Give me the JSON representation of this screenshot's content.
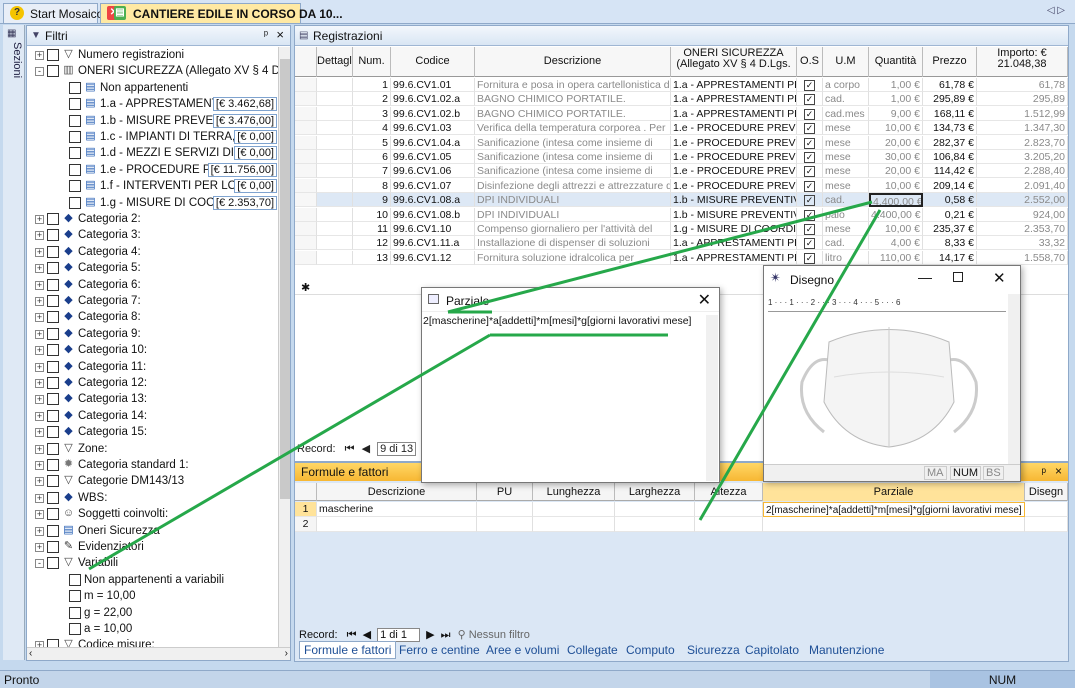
{
  "tabs": [
    {
      "label": "Start Mosaico"
    },
    {
      "label": "CANTIERE EDILE IN CORSO DA 10..."
    }
  ],
  "nav_arrows": "◁ ▷",
  "sidebar": {
    "vertical_label": "Sezioni"
  },
  "filtri": {
    "title": "Filtri",
    "tree": [
      {
        "label": "Numero registrazioni",
        "icon": "filter",
        "level": 0,
        "expander": "+"
      },
      {
        "label": "ONERI SICUREZZA (Allegato XV § 4 D.Lgs.",
        "icon": "book",
        "level": 0,
        "expander": "-"
      },
      {
        "label": "Non appartenenti",
        "icon": "doc",
        "level": 1
      },
      {
        "label": "1.a - APPRESTAMENTI PRE",
        "icon": "doc",
        "level": 1,
        "value": "[€ 3.462,68]"
      },
      {
        "label": "1.b - MISURE PREVENTIVE E",
        "icon": "doc",
        "level": 1,
        "value": "[€ 3.476,00]"
      },
      {
        "label": "1.c - IMPIANTI DI TERRA, DI PR",
        "icon": "doc",
        "level": 1,
        "value": "[€ 0,00]"
      },
      {
        "label": "1.d - MEZZI E SERVIZI DI PROTE",
        "icon": "doc",
        "level": 1,
        "value": "[€ 0,00]"
      },
      {
        "label": "1.e - PROCEDURE PREVIS",
        "icon": "doc",
        "level": 1,
        "value": "[€ 11.756,00]"
      },
      {
        "label": "1.f - INTERVENTI PER LO SFASA",
        "icon": "doc",
        "level": 1,
        "value": "[€ 0,00]"
      },
      {
        "label": "1.g - MISURE DI COORDIN",
        "icon": "doc",
        "level": 1,
        "value": "[€ 2.353,70]"
      },
      {
        "label": "Categoria 2:",
        "icon": "books",
        "level": 0,
        "expander": "+"
      },
      {
        "label": "Categoria 3:",
        "icon": "books",
        "level": 0,
        "expander": "+"
      },
      {
        "label": "Categoria 4:",
        "icon": "books",
        "level": 0,
        "expander": "+"
      },
      {
        "label": "Categoria 5:",
        "icon": "books",
        "level": 0,
        "expander": "+"
      },
      {
        "label": "Categoria 6:",
        "icon": "books",
        "level": 0,
        "expander": "+"
      },
      {
        "label": "Categoria 7:",
        "icon": "books",
        "level": 0,
        "expander": "+"
      },
      {
        "label": "Categoria 8:",
        "icon": "books",
        "level": 0,
        "expander": "+"
      },
      {
        "label": "Categoria 9:",
        "icon": "books",
        "level": 0,
        "expander": "+"
      },
      {
        "label": "Categoria 10:",
        "icon": "books",
        "level": 0,
        "expander": "+"
      },
      {
        "label": "Categoria 11:",
        "icon": "books",
        "level": 0,
        "expander": "+"
      },
      {
        "label": "Categoria 12:",
        "icon": "books",
        "level": 0,
        "expander": "+"
      },
      {
        "label": "Categoria 13:",
        "icon": "books",
        "level": 0,
        "expander": "+"
      },
      {
        "label": "Categoria 14:",
        "icon": "books",
        "level": 0,
        "expander": "+"
      },
      {
        "label": "Categoria 15:",
        "icon": "books",
        "level": 0,
        "expander": "+"
      },
      {
        "label": "Zone:",
        "icon": "filter",
        "level": 0,
        "expander": "+"
      },
      {
        "label": "Categoria standard 1:",
        "icon": "gear",
        "level": 0,
        "expander": "+"
      },
      {
        "label": "Categorie DM143/13",
        "icon": "filter",
        "level": 0,
        "expander": "+"
      },
      {
        "label": "WBS:",
        "icon": "books",
        "level": 0,
        "expander": "+"
      },
      {
        "label": "Soggetti coinvolti:",
        "icon": "person",
        "level": 0,
        "expander": "+"
      },
      {
        "label": "Oneri Sicurezza",
        "icon": "doc",
        "level": 0,
        "expander": "+"
      },
      {
        "label": "Evidenziatori",
        "icon": "pen",
        "level": 0,
        "expander": "+"
      },
      {
        "label": "Variabili",
        "icon": "filter",
        "level": 0,
        "expander": "-"
      },
      {
        "label": "Non appartenenti a variabili",
        "level": 1
      },
      {
        "label": "m = 10,00",
        "level": 1
      },
      {
        "label": "g = 22,00",
        "level": 1
      },
      {
        "label": "a = 10,00",
        "level": 1
      },
      {
        "label": "Codice misure:",
        "icon": "filter",
        "level": 0,
        "expander": "+"
      }
    ]
  },
  "registrazioni": {
    "title": "Registrazioni",
    "columns": [
      "Dettagli",
      "Num.",
      "Codice",
      "Descrizione",
      "ONERI SICUREZZA (Allegato XV § 4 D.Lgs.",
      "O.S",
      "U.M",
      "Quantità",
      "Prezzo",
      "Importo: € 21.048,38"
    ],
    "rows": [
      [
        "1",
        "99.6.CV1.01",
        "Fornitura e posa in opera cartellonistica di",
        "1.a - APPRESTAMENTI PRE",
        "a corpo",
        "1,00 €",
        "61,78 €",
        "61,78"
      ],
      [
        "2",
        "99.6.CV1.02.a",
        "BAGNO CHIMICO PORTATILE.",
        "1.a - APPRESTAMENTI PRE",
        "cad.",
        "1,00 €",
        "295,89 €",
        "295,89"
      ],
      [
        "3",
        "99.6.CV1.02.b",
        "BAGNO CHIMICO PORTATILE.",
        "1.a - APPRESTAMENTI PRE",
        "cad.mes",
        "9,00 €",
        "168,11 €",
        "1.512,99"
      ],
      [
        "4",
        "99.6.CV1.03",
        "Verifica della temperatura corporea . Per",
        "1.e - PROCEDURE PREVIST",
        "mese",
        "10,00 €",
        "134,73 €",
        "1.347,30"
      ],
      [
        "5",
        "99.6.CV1.04.a",
        "Sanificazione (intesa come insieme di",
        "1.e - PROCEDURE PREVIST",
        "mese",
        "20,00 €",
        "282,37 €",
        "2.823,70"
      ],
      [
        "6",
        "99.6.CV1.05",
        "Sanificazione (intesa come insieme di",
        "1.e - PROCEDURE PREVIST",
        "mese",
        "30,00 €",
        "106,84 €",
        "3.205,20"
      ],
      [
        "7",
        "99.6.CV1.06",
        "Sanificazione (intesa come insieme di",
        "1.e - PROCEDURE PREVIST",
        "mese",
        "20,00 €",
        "114,42 €",
        "2.288,40"
      ],
      [
        "8",
        "99.6.CV1.07",
        "Disinfezione degli attrezzi e attrezzature di",
        "1.e - PROCEDURE PREVIST",
        "mese",
        "10,00 €",
        "209,14 €",
        "2.091,40"
      ],
      [
        "9",
        "99.6.CV1.08.a",
        "DPI INDIVIDUALI",
        "1.b - MISURE PREVENTIVE",
        "cad.",
        "4.400,00 €",
        "0,58 €",
        "2.552,00"
      ],
      [
        "10",
        "99.6.CV1.08.b",
        "DPI INDIVIDUALI",
        "1.b - MISURE PREVENTIVE",
        "paio",
        "4.400,00 €",
        "0,21 €",
        "924,00"
      ],
      [
        "11",
        "99.6.CV1.10",
        "Compenso giornaliero per l'attività del",
        "1.g - MISURE DI COORDINA",
        "mese",
        "10,00 €",
        "235,37 €",
        "2.353,70"
      ],
      [
        "12",
        "99.6.CV1.11.a",
        "Installazione di dispenser di soluzioni",
        "1.a - APPRESTAMENTI PRE",
        "cad.",
        "4,00 €",
        "8,33 €",
        "33,32"
      ],
      [
        "13",
        "99.6.CV1.12",
        "Fornitura soluzione idralcolica per",
        "1.a - APPRESTAMENTI PRE",
        "litro",
        "110,00 €",
        "14,17 €",
        "1.558,70"
      ]
    ],
    "new_row_marker": "✱",
    "record_label": "Record:",
    "record_value": "9 di 13"
  },
  "formule": {
    "title": "Formule e fattori",
    "columns": [
      "Descrizione",
      "PU",
      "Lunghezza",
      "Larghezza",
      "Altezza",
      "Parziale",
      "Disegn"
    ],
    "rows": [
      {
        "n": "1",
        "descrizione": "mascherine",
        "parziale": "2[mascherine]*a[addetti]*m[mesi]*g[giorni lavorativi mese]"
      },
      {
        "n": "2",
        "descrizione": "",
        "parziale": ""
      }
    ],
    "record_label": "Record:",
    "record_value": "1 di 1",
    "filter_label": "Nessun filtro"
  },
  "bottom_tabs": [
    "Formule e fattori",
    "Ferro e centine",
    "Aree e volumi",
    "Collegate",
    "Computo",
    "Sicurezza",
    "Capitolato",
    "Manutenzione"
  ],
  "parziale_dialog": {
    "title": "Parziale",
    "text": "2[mascherine]*a[addetti]*m[mesi]*g[giorni lavorativi mese]"
  },
  "disegno_dialog": {
    "title": "Disegno",
    "ruler": "1 · · · 1 · · · 2 · · · 3 · · · 4 · · · 5 · · · 6",
    "status": [
      "MA",
      "NUM",
      "BS"
    ]
  },
  "statusbar": {
    "left": "Pronto",
    "right": "NUM"
  },
  "colors": {
    "accent": "#f7b733",
    "highlight": "#26a84a",
    "selected_tab": "#ffe9a3"
  }
}
